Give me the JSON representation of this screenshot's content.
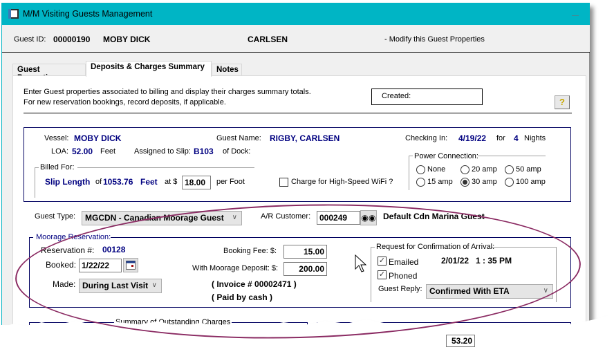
{
  "window": {
    "title": "M/M Visiting Guests Management",
    "icon": "window-app-icon",
    "minimize_icon": "minimize-icon"
  },
  "header": {
    "guest_id_label": "Guest ID:",
    "guest_id": "00000190",
    "vessel_name": "MOBY DICK",
    "last_name": "CARLSEN",
    "mode_text": "- Modify this Guest Properties"
  },
  "tabs": [
    {
      "label": "Guest Properties",
      "active": false
    },
    {
      "label": "Deposits & Charges Summary",
      "active": true
    },
    {
      "label": "Notes",
      "active": false
    }
  ],
  "intro": {
    "line1": "Enter Guest properties associated to billing and display their charges summary totals.",
    "line2": "For new reservation bookings, record deposits, if applicable.",
    "created_label": "Created:",
    "help_icon": "help-document-icon"
  },
  "vessel_info": {
    "vessel_label": "Vessel:",
    "vessel_value": "MOBY DICK",
    "guest_name_label": "Guest Name:",
    "guest_name_value": "RIGBY, CARLSEN",
    "checkin_label": "Checking In:",
    "checkin_date": "4/19/22",
    "for_label": "for",
    "nights_value": "4",
    "nights_label": "Nights",
    "loa_label": "LOA:",
    "loa_value": "52.00",
    "loa_unit": "Feet",
    "slip_label": "Assigned to Slip:",
    "slip_value": "B103",
    "dock_label": "of Dock:",
    "billed_for_title": "Billed For:",
    "billed_item": "Slip Length",
    "billed_of_label": "of",
    "billed_qty": "1053.76",
    "billed_unit": "Feet",
    "rate_label": "at $",
    "rate_value": "18.00",
    "rate_unit": "per Foot",
    "wifi_label": "Charge for High-Speed WiFi ?",
    "wifi_checked": false,
    "power_title": "Power Connection:",
    "power_options": [
      {
        "label": "None",
        "selected": false
      },
      {
        "label": "20 amp",
        "selected": false
      },
      {
        "label": "50 amp",
        "selected": false
      },
      {
        "label": "15 amp",
        "selected": false
      },
      {
        "label": "30 amp",
        "selected": true
      },
      {
        "label": "100 amp",
        "selected": false
      }
    ]
  },
  "guest_type": {
    "label": "Guest Type:",
    "value": "MGCDN - Canadian Moorage Guest",
    "ar_label": "A/R Customer:",
    "ar_value": "000249",
    "ar_lookup_icon": "binoculars-icon",
    "ar_name": "Default Cdn Marina Guest"
  },
  "reservation": {
    "title": "Moorage Reservation:",
    "res_label": "Reservation #:",
    "res_value": "00128",
    "booked_label": "Booked:",
    "booked_value": "1/22/22",
    "calendar_icon": "calendar-icon",
    "made_label": "Made:",
    "made_value": "During Last Visit",
    "booking_fee_label": "Booking Fee:  $:",
    "booking_fee_value": "15.00",
    "deposit_label": "With Moorage Deposit:  $:",
    "deposit_value": "200.00",
    "invoice_text": "( Invoice # 00002471 )",
    "paid_text": "( Paid by cash )",
    "confirm_title": "Request for Confirmation of Arrival:",
    "emailed_label": "Emailed",
    "emailed_checked": true,
    "emailed_datetime": "2/01/22   1 : 35 PM",
    "phoned_label": "Phoned",
    "phoned_checked": true,
    "reply_label": "Guest Reply:",
    "reply_value": "Confirmed With ETA"
  },
  "summary": {
    "title": "Summary of Outstanding Charges",
    "partial_value": "53.20"
  },
  "colors": {
    "titlebar": "#00b5c5",
    "navy_text": "#000080",
    "annotation_ellipse": "#8a2a62"
  }
}
